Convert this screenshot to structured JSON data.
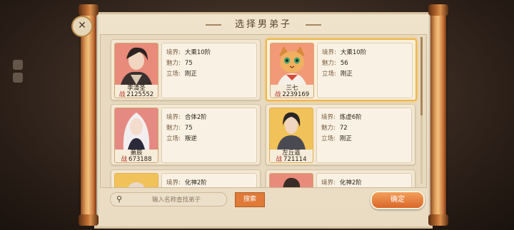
{
  "dialog": {
    "title": "选择男弟子",
    "confirm_label": "确定",
    "search_label": "搜索",
    "search_placeholder": "输入名称查找弟子"
  },
  "labels": {
    "realm": "境界:",
    "charm": "魅力:",
    "stance": "立场:",
    "power": "战"
  },
  "disciples": [
    {
      "name": "李清圣",
      "power": "2125552",
      "realm": "大乘10阶",
      "charm": "75",
      "stance": "刚正",
      "selected": false
    },
    {
      "name": "三七",
      "power": "2239169",
      "realm": "大乘10阶",
      "charm": "56",
      "stance": "刚正",
      "selected": true
    },
    {
      "name": "萧辰",
      "power": "673188",
      "realm": "合体2阶",
      "charm": "75",
      "stance": "叛逆",
      "selected": false
    },
    {
      "name": "左丘遥",
      "power": "721114",
      "realm": "炼虚6阶",
      "charm": "72",
      "stance": "刚正",
      "selected": false
    },
    {
      "name": "",
      "power": "",
      "realm": "化神2阶",
      "charm": "",
      "stance": "",
      "selected": false
    },
    {
      "name": "",
      "power": "",
      "realm": "化神2阶",
      "charm": "",
      "stance": "",
      "selected": false
    }
  ],
  "colors": {
    "accent": "#e07a38",
    "selected_border": "#f0b64a",
    "power_red": "#b03020"
  }
}
